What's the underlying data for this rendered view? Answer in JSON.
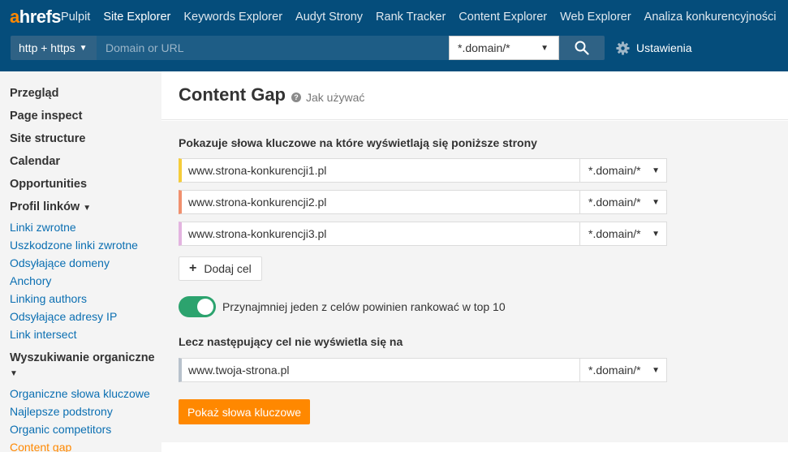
{
  "brand": {
    "logo_a": "a",
    "logo_rest": "hrefs",
    "accent": "#ff8800",
    "nav_bg": "#054d7b"
  },
  "nav": {
    "items": [
      {
        "label": "Pulpit"
      },
      {
        "label": "Site Explorer",
        "active": true
      },
      {
        "label": "Keywords Explorer"
      },
      {
        "label": "Audyt Strony"
      },
      {
        "label": "Rank Tracker"
      },
      {
        "label": "Content Explorer"
      },
      {
        "label": "Web Explorer"
      },
      {
        "label": "Analiza konkurencyjności"
      }
    ]
  },
  "search": {
    "protocol": "http + https",
    "placeholder": "Domain or URL",
    "mode": "*.domain/*",
    "settings_label": "Ustawienia"
  },
  "sidebar": {
    "overview": "Przegląd",
    "page_inspect": "Page inspect",
    "site_structure": "Site structure",
    "calendar": "Calendar",
    "opportunities": "Opportunities",
    "backlink_profile": "Profil linków",
    "backlink_links": [
      "Linki zwrotne",
      "Uszkodzone linki zwrotne",
      "Odsyłające domeny",
      "Anchory",
      "Linking authors",
      "Odsyłające adresy IP",
      "Link intersect"
    ],
    "organic_search": "Wyszukiwanie organiczne",
    "organic_links": [
      "Organiczne słowa kluczowe",
      "Najlepsze podstrony",
      "Organic competitors",
      "Content gap"
    ],
    "active_item": "Content gap"
  },
  "main": {
    "title": "Content Gap",
    "help_label": "Jak używać",
    "targets_label": "Pokazuje słowa kluczowe na które wyświetlają się poniższe strony",
    "targets": [
      {
        "url": "www.strona-konkurencji1.pl",
        "mode": "*.domain/*",
        "color": "#f5cc3a"
      },
      {
        "url": "www.strona-konkurencji2.pl",
        "mode": "*.domain/*",
        "color": "#f0906e"
      },
      {
        "url": "www.strona-konkurencji3.pl",
        "mode": "*.domain/*",
        "color": "#e3b4e0"
      }
    ],
    "add_target_label": "Dodaj cel",
    "toggle_label": "Przynajmniej jeden z celów powinien rankować w top 10",
    "toggle_on": true,
    "exclude_label": "Lecz następujący cel nie wyświetla się na",
    "exclude_target": {
      "url": "www.twoja-strona.pl",
      "mode": "*.domain/*",
      "color": "#b8c2cc"
    },
    "submit_label": "Pokaż słowa kluczowe"
  }
}
